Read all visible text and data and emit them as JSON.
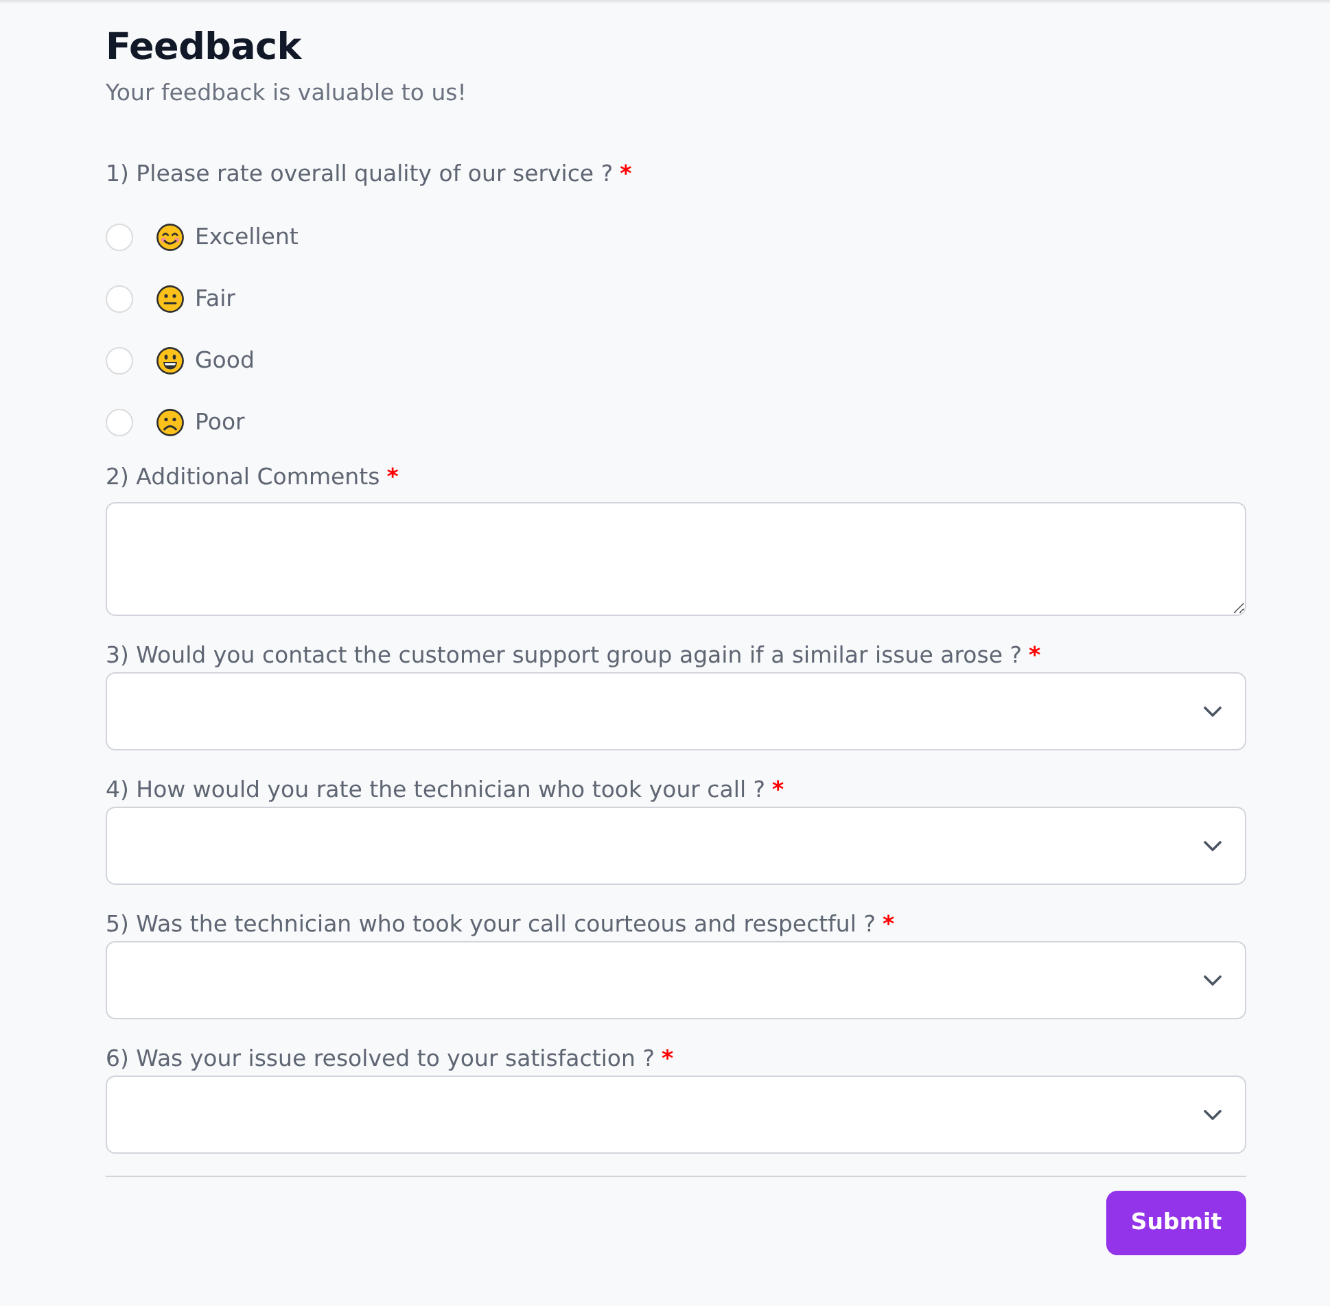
{
  "header": {
    "title": "Feedback",
    "subtitle": "Your feedback is valuable to us!"
  },
  "questions": [
    {
      "kind": "radio",
      "label": "1) Please rate overall quality of our service ?",
      "required_mark": "*",
      "options": [
        {
          "label": "Excellent",
          "kind": "smiling",
          "selected": false
        },
        {
          "label": "Fair",
          "kind": "neutral",
          "selected": false
        },
        {
          "label": "Good",
          "kind": "grinning",
          "selected": false
        },
        {
          "label": "Poor",
          "kind": "frowning",
          "selected": false
        }
      ]
    },
    {
      "kind": "textarea",
      "label": "2) Additional Comments",
      "required_mark": "*"
    },
    {
      "kind": "select",
      "label": "3) Would you contact the customer support group again if a similar issue arose ?",
      "required_mark": "*"
    },
    {
      "kind": "select",
      "label": "4) How would you rate the technician who took your call ?",
      "required_mark": "*"
    },
    {
      "kind": "select",
      "label": "5) Was the technician who took your call courteous and respectful ?",
      "required_mark": "*"
    },
    {
      "kind": "select",
      "label": "6) Was your issue resolved to your satisfaction ?",
      "required_mark": "*"
    }
  ],
  "submit": {
    "label": "Submit"
  }
}
